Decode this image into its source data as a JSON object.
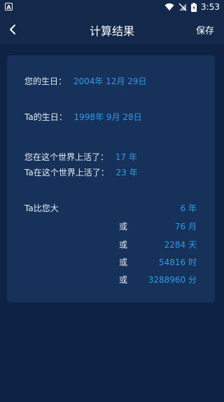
{
  "status": {
    "time": "3:53",
    "left_icon": "A"
  },
  "app_bar": {
    "title": "计算结果",
    "save_label": "保存",
    "back_icon": "chevron-left"
  },
  "result": {
    "your_birthday_label": "您的生日：",
    "your_birthday_value": "2004年 12月 29日",
    "ta_birthday_label": "Ta的生日：",
    "ta_birthday_value": "1998年 9月 28日",
    "you_lived_label": "您在这个世界上活了：",
    "you_lived_value": "17 年",
    "ta_lived_label": "Ta在这个世界上活了：",
    "ta_lived_value": "23 年",
    "diff_label": "Ta比您大",
    "diff_years": "6 年",
    "or_label": "或",
    "diff_months": "76 月",
    "diff_days": "2284 天",
    "diff_hours": "54816 时",
    "diff_minutes": "3288960 分"
  },
  "colors": {
    "background": "#0d2244",
    "card": "#16325a",
    "accent": "#2f9be6"
  }
}
